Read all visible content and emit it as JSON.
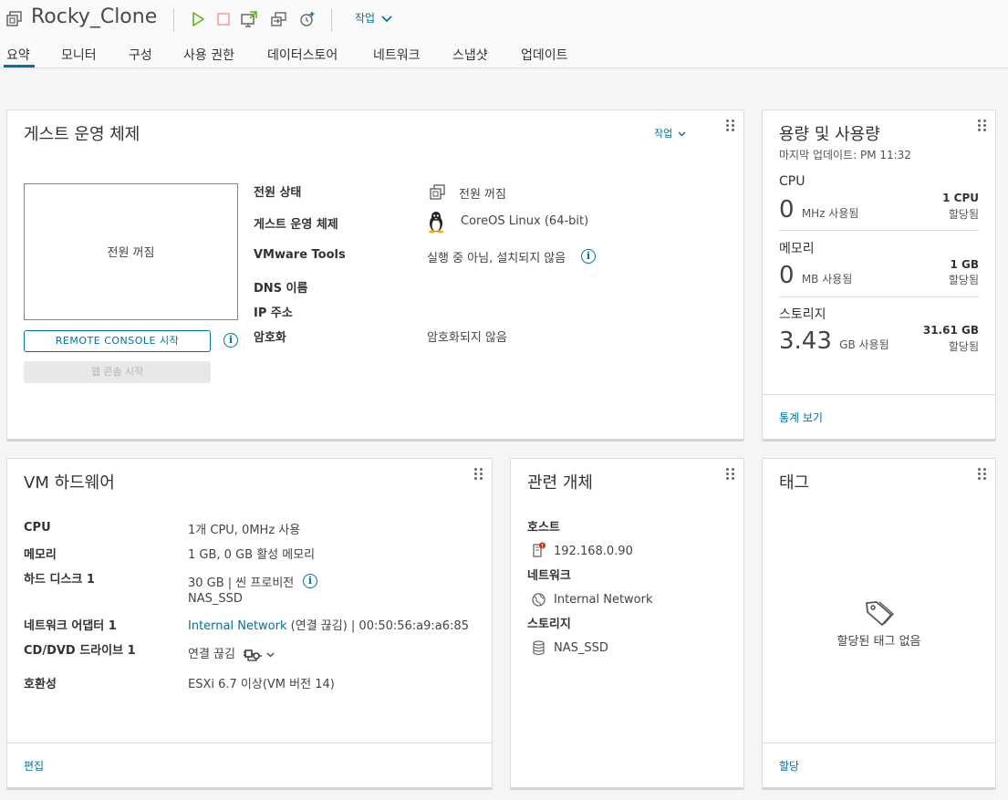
{
  "header": {
    "title": "Rocky_Clone",
    "actions_label": "작업",
    "toolbar_icons": [
      "power-on-icon",
      "power-off-icon",
      "launch-console-icon",
      "migrate-icon",
      "snapshot-icon"
    ]
  },
  "tabs": [
    "요약",
    "모니터",
    "구성",
    "사용 권한",
    "데이터스토어",
    "네트워크",
    "스냅샷",
    "업데이트"
  ],
  "guest_os": {
    "title": "게스트 운영 체제",
    "actions_label": "작업",
    "console_state": "전원 꺼짐",
    "remote_console_btn": "REMOTE CONSOLE 시작",
    "web_console_btn": "웹 콘솔 시작",
    "fields": {
      "power_label": "전원 상태",
      "power_value": "전원 꺼짐",
      "os_label": "게스트 운영 체제",
      "os_value": "CoreOS Linux (64-bit)",
      "tools_label": "VMware Tools",
      "tools_value": "실행 중 아님, 설치되지 않음",
      "dns_label": "DNS 이름",
      "ip_label": "IP 주소",
      "enc_label": "암호화",
      "enc_value": "암호화되지 않음"
    }
  },
  "capacity": {
    "title": "용량 및 사용량",
    "last_update": "마지막 업데이트: PM 11:32",
    "cpu": {
      "label": "CPU",
      "value": "0",
      "unit": "MHz 사용됨",
      "total": "1 CPU",
      "alloc": "할당됨"
    },
    "memory": {
      "label": "메모리",
      "value": "0",
      "unit": "MB 사용됨",
      "total": "1 GB",
      "alloc": "할당됨"
    },
    "storage": {
      "label": "스토리지",
      "value": "3.43",
      "unit": "GB 사용됨",
      "total": "31.61 GB",
      "alloc": "할당됨"
    },
    "stats_link": "통계 보기"
  },
  "hardware": {
    "title": "VM 하드웨어",
    "cpu_label": "CPU",
    "cpu_value": "1개 CPU, 0MHz 사용",
    "mem_label": "메모리",
    "mem_value": "1 GB, 0 GB 활성 메모리",
    "disk_label": "하드 디스크 1",
    "disk_value": "30 GB | 씬 프로비전",
    "disk_datastore": "NAS_SSD",
    "nic_label": "네트워크 어댑터 1",
    "nic_network": "Internal Network",
    "nic_status": "(연결 끊김) | 00:50:56:a9:a6:85",
    "cd_label": "CD/DVD 드라이브 1",
    "cd_value": "연결 끊김",
    "compat_label": "호환성",
    "compat_value": "ESXi 6.7 이상(VM 버전 14)",
    "edit_link": "편집"
  },
  "related": {
    "title": "관련 개체",
    "host_label": "호스트",
    "host_value": "192.168.0.90",
    "network_label": "네트워크",
    "network_value": "Internal Network",
    "storage_label": "스토리지",
    "storage_value": "NAS_SSD"
  },
  "tags": {
    "title": "태그",
    "empty": "할당된 태그 없음",
    "assign_link": "할당"
  },
  "colors": {
    "accent": "#0072a3",
    "power_on": "#5eb715",
    "power_off": "#e57373",
    "alert": "#e62700"
  }
}
